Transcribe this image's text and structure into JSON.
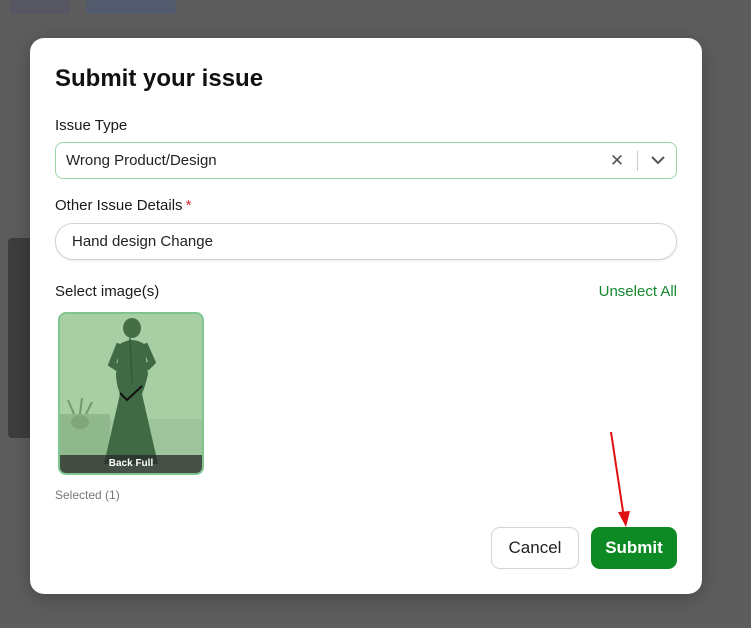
{
  "modal": {
    "title": "Submit your issue",
    "issue_type_label": "Issue Type",
    "issue_type_value": "Wrong Product/Design",
    "details_label": "Other Issue Details",
    "details_required_mark": "*",
    "details_value": "Hand design Change",
    "select_images_label": "Select image(s)",
    "unselect_all_label": "Unselect All",
    "images": [
      {
        "caption": "Back Full",
        "selected": true
      }
    ],
    "selected_count_text": "Selected (1)",
    "cancel_label": "Cancel",
    "submit_label": "Submit"
  },
  "icons": {
    "clear": "close-icon",
    "dropdown": "chevron-down-icon",
    "check": "checkmark-icon"
  },
  "colors": {
    "accent": "#0e8a25",
    "link": "#168a2f",
    "required": "#d32f2f",
    "annotation_arrow": "#e01010"
  }
}
